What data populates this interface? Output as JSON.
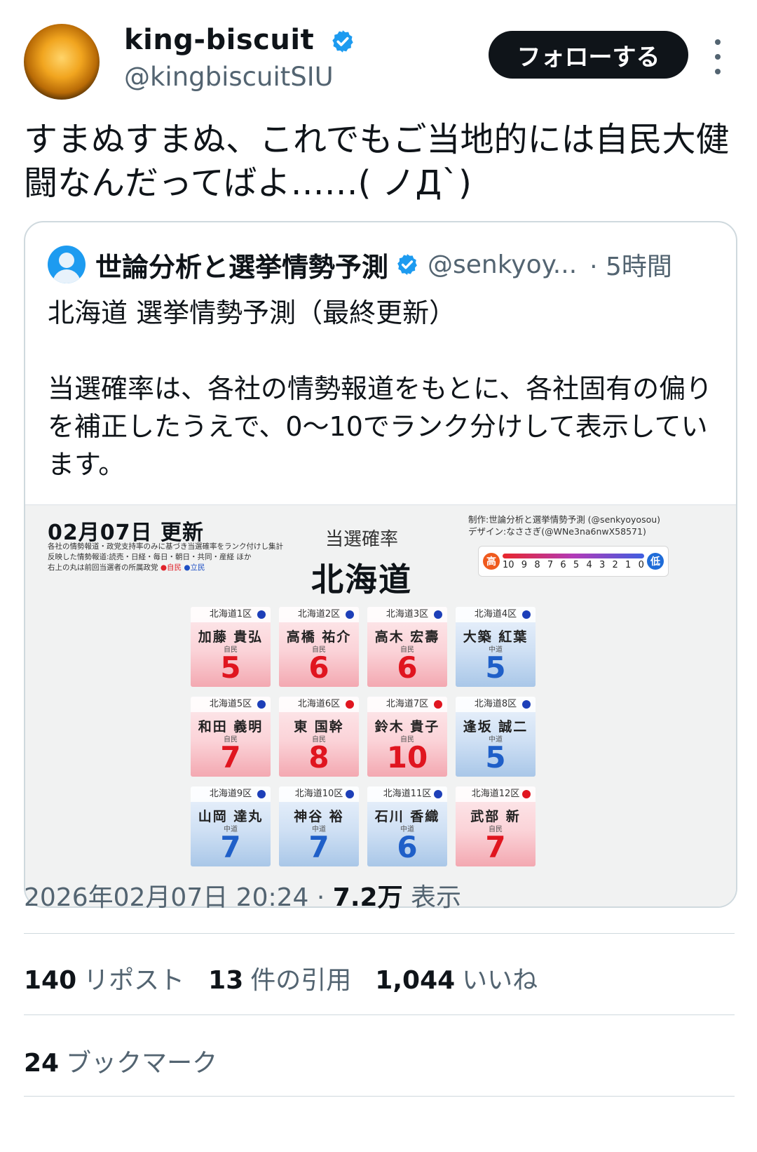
{
  "author": {
    "name": "king-biscuit",
    "handle": "@kingbiscuitSIU",
    "follow_label": "フォローする"
  },
  "tweet_text": "すまぬすまぬ、これでもご当地的には自民大健闘なんだってばよ……( ノД`)",
  "quote": {
    "name": "世論分析と選挙情勢予測",
    "handle": "@senkyoy...",
    "time": "· 5時間",
    "text": "北海道 選挙情勢予測（最終更新）\n\n当選確率は、各社の情勢報道をもとに、各社固有の偏りを補正したうえで、0〜10でランク分けして表示しています。"
  },
  "infographic": {
    "date": "02月07日 更新",
    "note_1": "各社の情勢報道・政党支持率のみに基づき当選確率をランク付けし集計",
    "note_2": "反映した情勢報道:読売・日経・毎日・朝日・共同・産経 ほか",
    "note_3": "右上の丸は前回当選者の所属政党",
    "legend_ldp": "●自民",
    "legend_cdp": "●立民",
    "title_small": "当選確率",
    "title_big": "北海道",
    "credit_1": "制作:世論分析と選挙情勢予測 (@senkyoyosou)",
    "credit_2": "デザイン:なささぎ(@WNe3na6nwX58571)",
    "scale_high": "高",
    "scale_low": "低",
    "scale_numbers": [
      "10",
      "9",
      "8",
      "7",
      "6",
      "5",
      "4",
      "3",
      "2",
      "1",
      "0"
    ],
    "districts": [
      {
        "district": "北海道1区",
        "name": "加藤 貴弘",
        "party": "自民",
        "score": "5",
        "prev": "blue"
      },
      {
        "district": "北海道2区",
        "name": "高橋 祐介",
        "party": "自民",
        "score": "6",
        "prev": "blue"
      },
      {
        "district": "北海道3区",
        "name": "高木 宏壽",
        "party": "自民",
        "score": "6",
        "prev": "blue"
      },
      {
        "district": "北海道4区",
        "name": "大築 紅葉",
        "party": "中道",
        "score": "5",
        "prev": "blue"
      },
      {
        "district": "北海道5区",
        "name": "和田 義明",
        "party": "自民",
        "score": "7",
        "prev": "blue"
      },
      {
        "district": "北海道6区",
        "name": "東 国幹",
        "party": "自民",
        "score": "8",
        "prev": "red"
      },
      {
        "district": "北海道7区",
        "name": "鈴木 貴子",
        "party": "自民",
        "score": "10",
        "prev": "red"
      },
      {
        "district": "北海道8区",
        "name": "逢坂 誠二",
        "party": "中道",
        "score": "5",
        "prev": "blue"
      },
      {
        "district": "北海道9区",
        "name": "山岡 達丸",
        "party": "中道",
        "score": "7",
        "prev": "blue"
      },
      {
        "district": "北海道10区",
        "name": "神谷 裕",
        "party": "中道",
        "score": "7",
        "prev": "blue"
      },
      {
        "district": "北海道11区",
        "name": "石川 香織",
        "party": "中道",
        "score": "6",
        "prev": "blue"
      },
      {
        "district": "北海道12区",
        "name": "武部 新",
        "party": "自民",
        "score": "7",
        "prev": "red"
      }
    ]
  },
  "meta": {
    "timestamp": "2026年02月07日 20:24",
    "separator": "·",
    "views_count": "7.2万",
    "views_label": "表示"
  },
  "stats": {
    "reposts_count": "140",
    "reposts_label": "リポスト",
    "quotes_count": "13",
    "quotes_label": "件の引用",
    "likes_count": "1,044",
    "likes_label": "いいね",
    "bookmarks_count": "24",
    "bookmarks_label": "ブックマーク"
  },
  "colors": {
    "follow_bg": "#0f1419",
    "verified": "#1d9bf0",
    "ldp_red": "#e0151f",
    "cdp_blue": "#1f5fc8"
  }
}
